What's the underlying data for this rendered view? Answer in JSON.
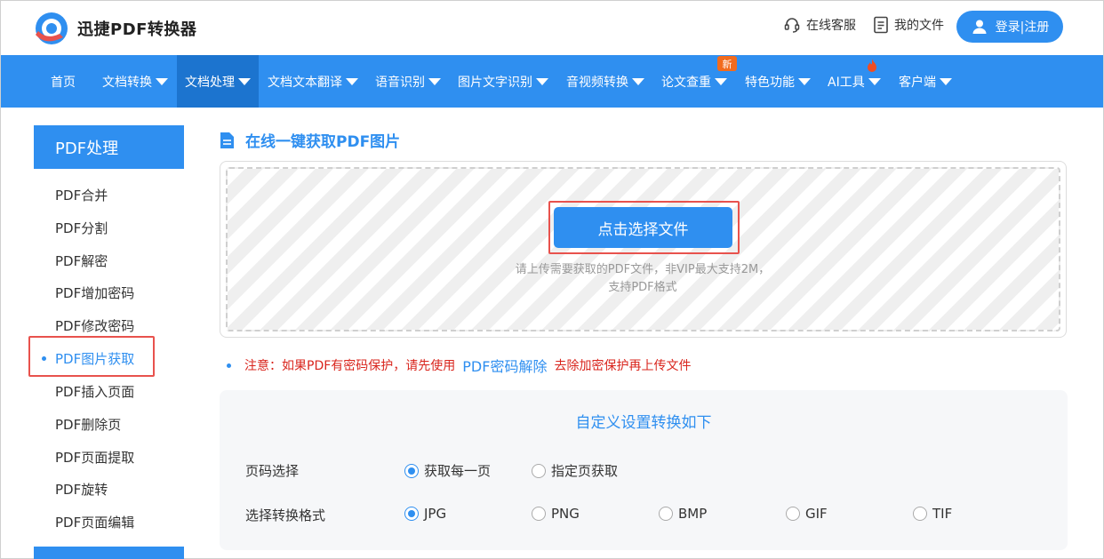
{
  "header": {
    "brand": "迅捷PDF转换器",
    "service_label": "在线客服",
    "files_label": "我的文件",
    "login_label": "登录|注册"
  },
  "nav": {
    "items": [
      {
        "label": "首页"
      },
      {
        "label": "文档转换"
      },
      {
        "label": "文档处理"
      },
      {
        "label": "文档文本翻译"
      },
      {
        "label": "语音识别"
      },
      {
        "label": "图片文字识别"
      },
      {
        "label": "音视频转换"
      },
      {
        "label": "论文查重"
      },
      {
        "label": "特色功能"
      },
      {
        "label": "AI工具"
      },
      {
        "label": "客户端"
      }
    ],
    "active_index": 2,
    "new_badge": "新"
  },
  "sidebar": {
    "title": "PDF处理",
    "items": [
      {
        "label": "PDF合并"
      },
      {
        "label": "PDF分割"
      },
      {
        "label": "PDF解密"
      },
      {
        "label": "PDF增加密码"
      },
      {
        "label": "PDF修改密码"
      },
      {
        "label": "PDF图片获取"
      },
      {
        "label": "PDF插入页面"
      },
      {
        "label": "PDF删除页"
      },
      {
        "label": "PDF页面提取"
      },
      {
        "label": "PDF旋转"
      },
      {
        "label": "PDF页面编辑"
      }
    ],
    "active_index": 5
  },
  "main": {
    "title": "在线一键获取PDF图片",
    "select_button": "点击选择文件",
    "hint_line1": "请上传需要获取的PDF文件，非VIP最大支持2M，",
    "hint_line2": "支持PDF格式",
    "notice_prefix": "注意：如果PDF有密码保护，请先使用",
    "notice_link": "PDF密码解除",
    "notice_suffix": "去除加密保护再上传文件"
  },
  "settings": {
    "title": "自定义设置转换如下",
    "page_label": "页码选择",
    "page_options": [
      "获取每一页",
      "指定页获取"
    ],
    "page_selected": "获取每一页",
    "format_label": "选择转换格式",
    "format_options": [
      "JPG",
      "PNG",
      "BMP",
      "GIF",
      "TIF"
    ],
    "format_selected": "JPG"
  },
  "colors": {
    "primary": "#2f8ff0",
    "nav_active": "#1c74cf",
    "highlight": "#e8524d",
    "notice": "#d9251d"
  }
}
